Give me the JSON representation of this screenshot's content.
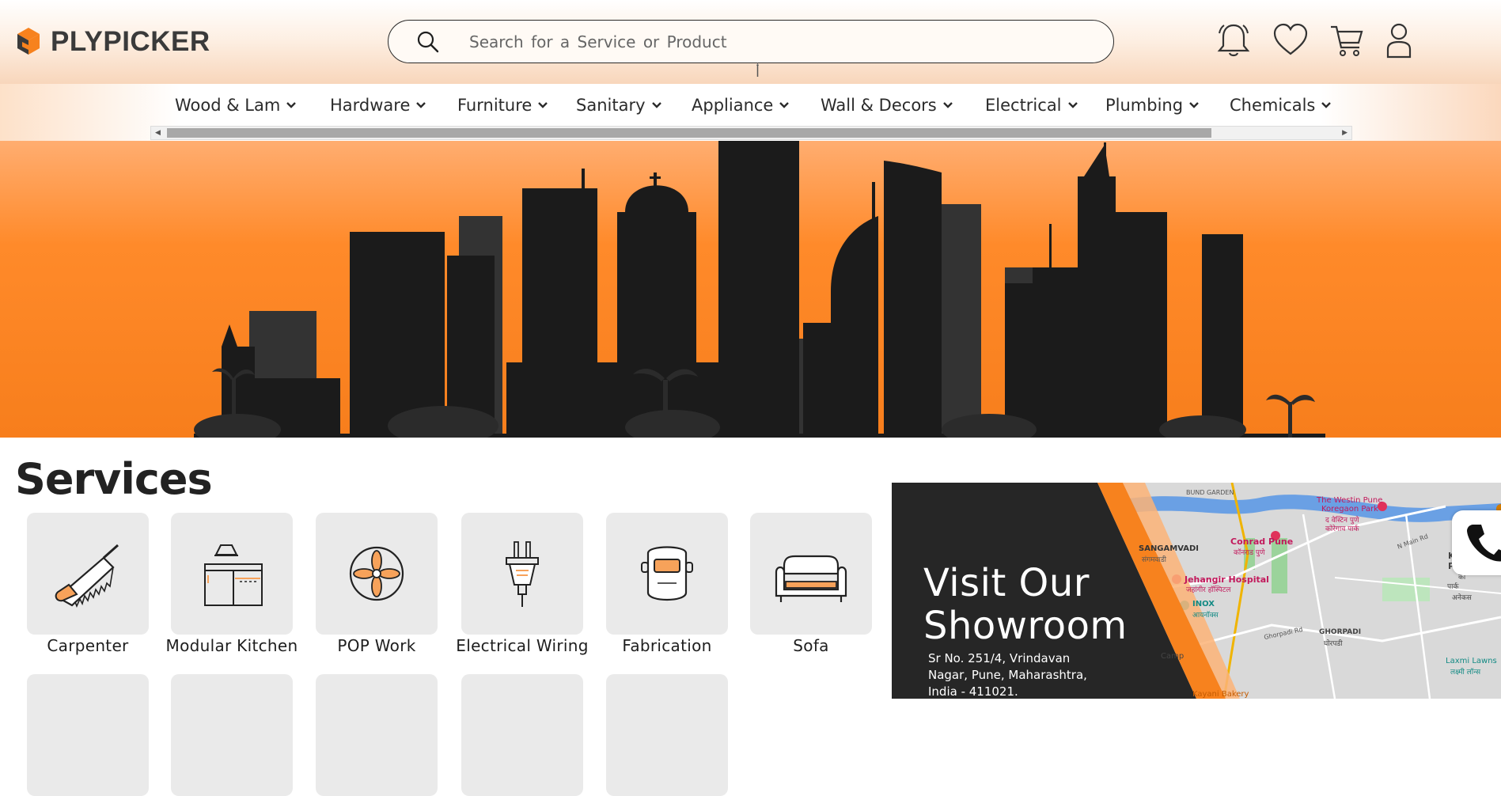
{
  "brand": {
    "name": "PLYPICKER",
    "accent": "#f7821e",
    "logo_dark": "#3a3a3a"
  },
  "search": {
    "placeholder": "Search for a Service or Product"
  },
  "header_icons": [
    "bell-icon",
    "heart-icon",
    "cart-icon",
    "user-icon"
  ],
  "nav": {
    "items": [
      {
        "label": "Wood & Lam"
      },
      {
        "label": "Hardware"
      },
      {
        "label": "Furniture"
      },
      {
        "label": "Sanitary"
      },
      {
        "label": "Appliance"
      },
      {
        "label": "Wall & Decors"
      },
      {
        "label": "Electrical"
      },
      {
        "label": "Plumbing"
      },
      {
        "label": "Chemicals"
      }
    ]
  },
  "services": {
    "title": "Services",
    "items": [
      {
        "label": "Carpenter",
        "icon": "saw-icon"
      },
      {
        "label": "Modular Kitchen",
        "icon": "kitchen-icon"
      },
      {
        "label": "POP Work",
        "icon": "pop-ceiling-icon"
      },
      {
        "label": "Electrical Wiring",
        "icon": "plug-icon"
      },
      {
        "label": "Fabrication",
        "icon": "welding-mask-icon"
      },
      {
        "label": "Sofa",
        "icon": "sofa-icon"
      }
    ]
  },
  "showroom": {
    "title_line1": "Visit Our",
    "title_line2": "Showroom",
    "address_line1": "Sr No. 251/4, Vrindavan",
    "address_line2": "Nagar, Pune, Maharashtra,",
    "address_line3": "India - 411021."
  },
  "map": {
    "labels": {
      "sangamvadi": "SANGAMVADI",
      "sangamvadi_local": "संगमवाडी",
      "westin": "The Westin Pune",
      "westin2": "Koregaon Park",
      "westin3": "द वेस्टिन पुणे",
      "westin4": "कोरेगाव पार्क",
      "conrad": "Conrad Pune",
      "conrad_local": "कॉनराड पुणे",
      "jehangir": "Jehangir Hospital",
      "jehangir_local": "जहांगीर हॉस्पिटल",
      "inox": "INOX",
      "inox_local": "आयनॉक्स",
      "ghorpadi": "GHORPADI",
      "ghorpadi_local": "घोरपडी",
      "koregaon": "KOR",
      "koregaon2": "PARK",
      "koregaon3": "को",
      "koregaon4": "पार्क",
      "anekas": "अनेकस",
      "laxmi": "Laxmi Lawns",
      "laxmi_local": "लक्ष्मी लॉन्स",
      "bund": "BUND GARDEN",
      "camp": "Camp",
      "kayani": "Kayani Bakery",
      "ghorpadi_rd": "Ghorpadi Rd",
      "n_main_rd": "N Main Rd"
    }
  }
}
